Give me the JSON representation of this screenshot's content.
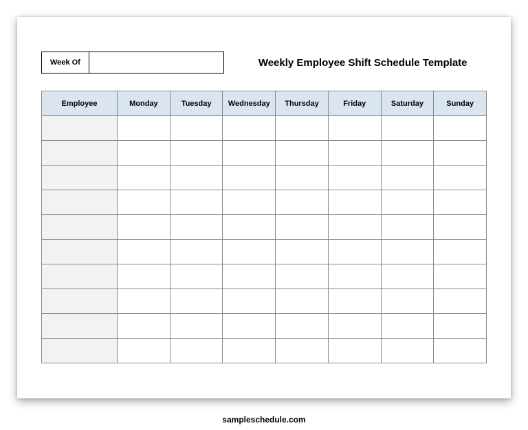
{
  "header": {
    "week_of_label": "Week Of",
    "week_of_value": "",
    "title": "Weekly Employee Shift Schedule Template"
  },
  "table": {
    "columns": [
      "Employee",
      "Monday",
      "Tuesday",
      "Wednesday",
      "Thursday",
      "Friday",
      "Saturday",
      "Sunday"
    ],
    "rows": [
      {
        "employee": "",
        "mon": "",
        "tue": "",
        "wed": "",
        "thu": "",
        "fri": "",
        "sat": "",
        "sun": ""
      },
      {
        "employee": "",
        "mon": "",
        "tue": "",
        "wed": "",
        "thu": "",
        "fri": "",
        "sat": "",
        "sun": ""
      },
      {
        "employee": "",
        "mon": "",
        "tue": "",
        "wed": "",
        "thu": "",
        "fri": "",
        "sat": "",
        "sun": ""
      },
      {
        "employee": "",
        "mon": "",
        "tue": "",
        "wed": "",
        "thu": "",
        "fri": "",
        "sat": "",
        "sun": ""
      },
      {
        "employee": "",
        "mon": "",
        "tue": "",
        "wed": "",
        "thu": "",
        "fri": "",
        "sat": "",
        "sun": ""
      },
      {
        "employee": "",
        "mon": "",
        "tue": "",
        "wed": "",
        "thu": "",
        "fri": "",
        "sat": "",
        "sun": ""
      },
      {
        "employee": "",
        "mon": "",
        "tue": "",
        "wed": "",
        "thu": "",
        "fri": "",
        "sat": "",
        "sun": ""
      },
      {
        "employee": "",
        "mon": "",
        "tue": "",
        "wed": "",
        "thu": "",
        "fri": "",
        "sat": "",
        "sun": ""
      },
      {
        "employee": "",
        "mon": "",
        "tue": "",
        "wed": "",
        "thu": "",
        "fri": "",
        "sat": "",
        "sun": ""
      },
      {
        "employee": "",
        "mon": "",
        "tue": "",
        "wed": "",
        "thu": "",
        "fri": "",
        "sat": "",
        "sun": ""
      }
    ]
  },
  "footer": {
    "text": "sampleschedule.com"
  }
}
